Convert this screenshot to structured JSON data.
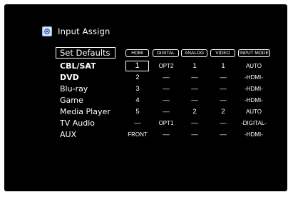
{
  "header": {
    "icon": "input-assign-icon",
    "title": "Input Assign"
  },
  "set_defaults": "Set Defaults",
  "columns": [
    "HDMI",
    "DIGITAL",
    "ANALOG",
    "VIDEO",
    "INPUT MODE"
  ],
  "rows": [
    {
      "label": "CBL/SAT",
      "values": [
        "1",
        "OPT2",
        "1",
        "1",
        "AUTO"
      ]
    },
    {
      "label": "DVD",
      "values": [
        "2",
        "—",
        "—",
        "—",
        "-HDMI-"
      ]
    },
    {
      "label": "Blu-ray",
      "values": [
        "3",
        "—",
        "—",
        "—",
        "-HDMI-"
      ]
    },
    {
      "label": "Game",
      "values": [
        "4",
        "—",
        "—",
        "—",
        "-HDMI-"
      ]
    },
    {
      "label": "Media Player",
      "values": [
        "5",
        "—",
        "2",
        "2",
        "AUTO"
      ]
    },
    {
      "label": "TV Audio",
      "values": [
        "—",
        "OPT1",
        "—",
        "—",
        "-DIGITAL-"
      ]
    },
    {
      "label": "AUX",
      "values": [
        "FRONT",
        "—",
        "—",
        "—",
        "-HDMI-"
      ]
    }
  ],
  "colors": {
    "background": "#000000",
    "text": "#ffffff",
    "icon": "#cfe2ff"
  }
}
